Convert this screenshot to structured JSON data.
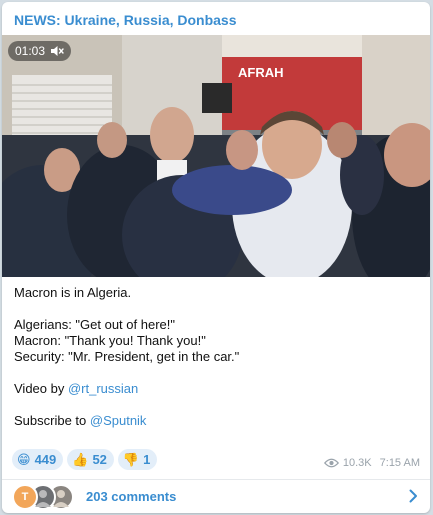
{
  "post": {
    "channel_name": "NEWS: Ukraine, Russia, Donbass",
    "video": {
      "duration": "01:03",
      "sound_icon": "muted-speaker-icon",
      "storefront_sign": "AFRAH"
    },
    "text": {
      "line1": "Macron is in Algeria.",
      "line2": "Algerians: \"Get out of here!\"",
      "line3": "Macron: \"Thank you! Thank you!\"",
      "line4": "Security: \"Mr. President, get in the car.\"",
      "video_by_prefix": "Video by ",
      "video_by_link": "@rt_russian",
      "subscribe_prefix": "Subscribe to ",
      "subscribe_link": "@Sputnik"
    },
    "reactions": [
      {
        "emoji": "😁",
        "count": "449"
      },
      {
        "emoji": "👍",
        "count": "52"
      },
      {
        "emoji": "👎",
        "count": "1"
      }
    ],
    "views": "10.3K",
    "time": "7:15 AM",
    "comments": {
      "avatars": [
        {
          "initial": "T",
          "color": "#f2a65a"
        },
        {
          "initial": "",
          "color": "#6d6f73"
        },
        {
          "initial": "",
          "color": "#8a8580"
        }
      ],
      "label": "203 comments"
    }
  },
  "colors": {
    "accent": "#3a8dd0",
    "background": "#d4dde4",
    "reaction_bg": "#e3eef9",
    "meta_text": "#9aa3ab"
  }
}
